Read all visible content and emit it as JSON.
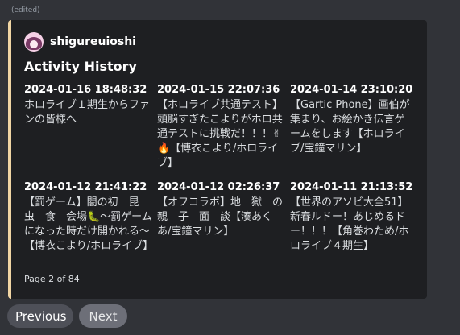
{
  "message": {
    "edited_label": "(edited)"
  },
  "embed": {
    "accent_color": "#f0d5a4",
    "author": {
      "name": "shigureuioshi",
      "avatar_icon": "anime-avatar-icon"
    },
    "title": "Activity History",
    "fields": [
      {
        "name": "2024-01-16 18:48:32",
        "value": "ホロライブ１期生からファンの皆様へ"
      },
      {
        "name": "2024-01-15 22:07:36",
        "value": "【ホロライブ共通テスト】頭脳すぎたこよりがホロ共通テストに挑戦だ！！！✌🔥【博衣こより/ホロライブ】"
      },
      {
        "name": "2024-01-14 23:10:20",
        "value": "【Gartic Phone】画伯が集まり、お絵かき伝言ゲームをします【ホロライブ/宝鐘マリン】"
      },
      {
        "name": "2024-01-12 21:41:22",
        "value": "【罰ゲーム】闇の初　昆　虫　食　会場🐛～罰ゲームになった時だけ開かれる～【博衣こより/ホロライブ】"
      },
      {
        "name": "2024-01-12 02:26:37",
        "value": "【オフコラボ】地　獄　の　親　子　面　談【湊あくあ/宝鐘マリン】"
      },
      {
        "name": "2024-01-11 21:13:52",
        "value": "【世界のアソビ大全51】新春ルドー！あじめるドー！！！【角巻わため/ホロライブ４期生】"
      }
    ],
    "footer": "Page 2 of 84"
  },
  "buttons": {
    "previous": "Previous",
    "next": "Next"
  }
}
